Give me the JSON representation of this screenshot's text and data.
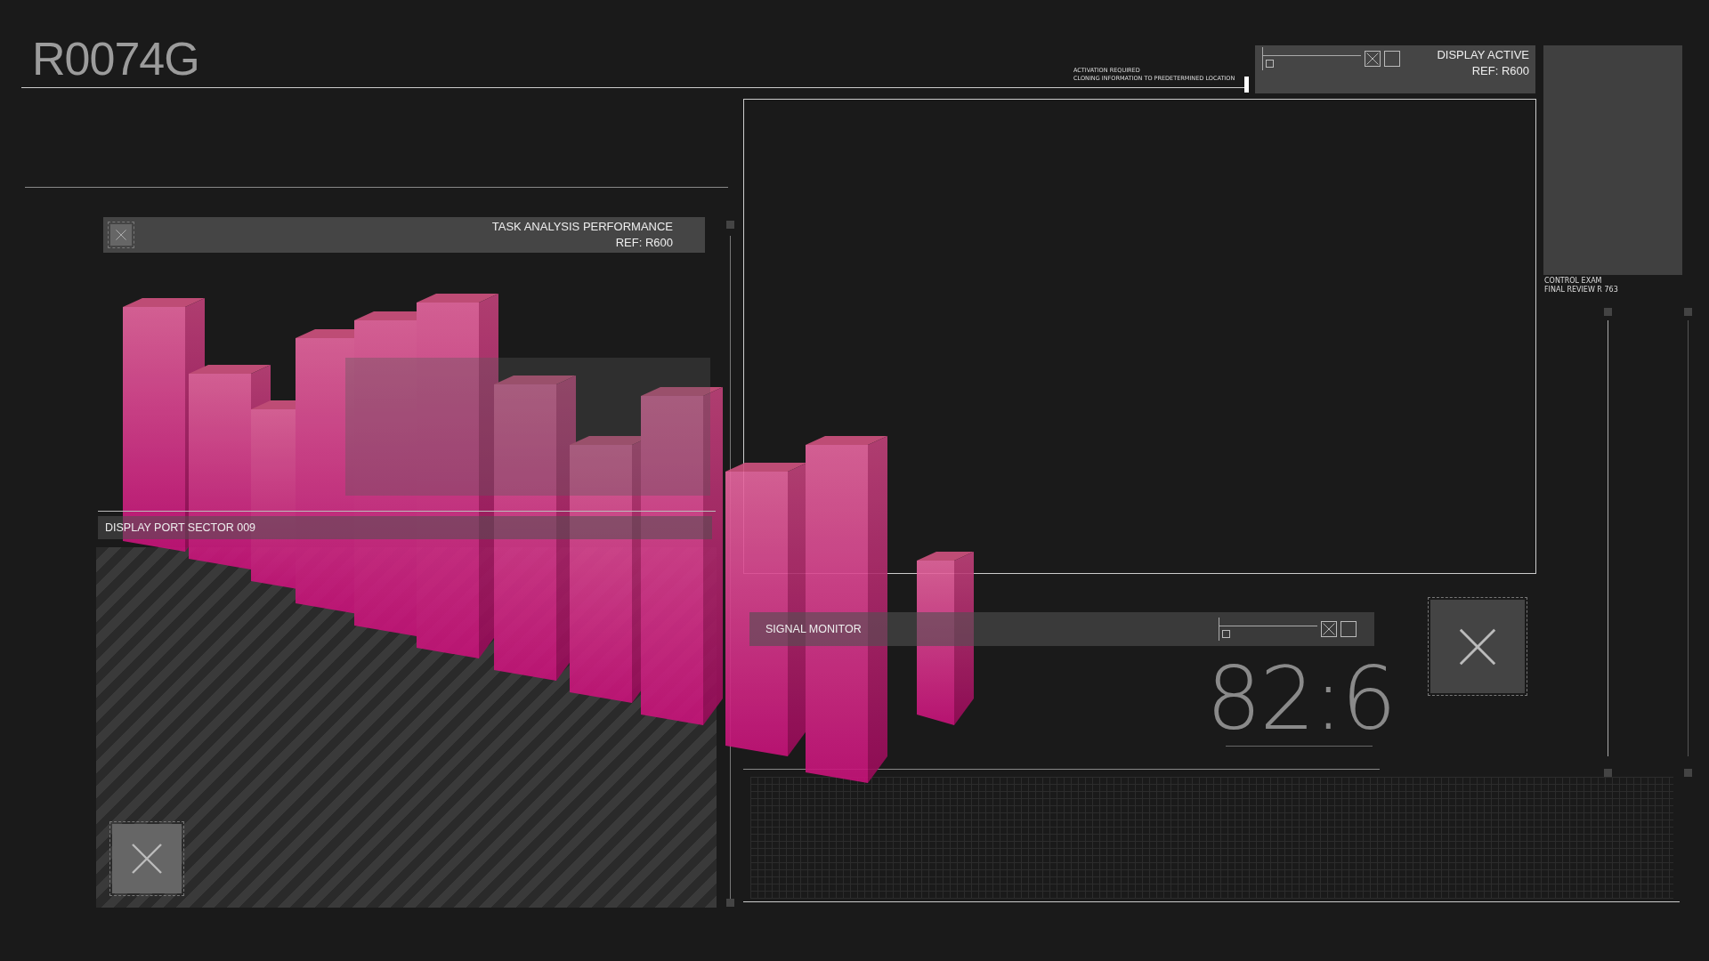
{
  "title": "R0074G",
  "header_note": [
    "ACTIVATION REQUIRED",
    "CLONING INFORMATION TO PREDETERMINED LOCATION"
  ],
  "display_panel": {
    "title": "DISPLAY ACTIVE",
    "ref": "REF: R600"
  },
  "side_caption": [
    "CONTROL EXAM",
    "FINAL REVIEW R 763"
  ],
  "task_panel": {
    "title": "TASK ANALYSIS PERFORMANCE",
    "ref": "REF: R600"
  },
  "port_panel": {
    "title": "DISPLAY PORT SECTOR 009"
  },
  "signal_monitor": {
    "title": "SIGNAL MONITOR",
    "reading": "82:6"
  }
}
